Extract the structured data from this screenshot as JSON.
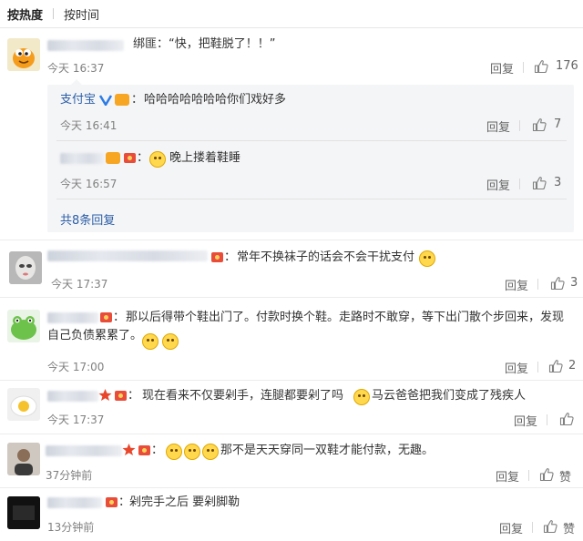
{
  "tabs": {
    "hot": "按热度",
    "time": "按时间"
  },
  "comments": [
    {
      "text": "绑匪：“快，把鞋脱了！！”",
      "time": "今天 16:37",
      "reply": "回复",
      "likes": "176",
      "replies": [
        {
          "name": "支付宝",
          "text": "哈哈哈哈哈哈哈你们戏好多",
          "time": "今天 16:41",
          "reply": "回复",
          "likes": "7"
        },
        {
          "text": "晚上搂着鞋睡",
          "time": "今天 16:57",
          "reply": "回复",
          "likes": "3"
        }
      ],
      "more": "共8条回复"
    },
    {
      "text": "常年不换袜子的话会不会干扰支付",
      "time": "今天 17:37",
      "reply": "回复",
      "likes": "3"
    },
    {
      "text": "那以后得带个鞋出门了。付款时换个鞋。走路时不敢穿，等下出门散个步回来，发现自己负债累累了。",
      "time": "今天 17:00",
      "reply": "回复",
      "likes": "2"
    },
    {
      "text_a": "现在看来不仅要剁手，连腿都要剁了吗",
      "text_b": "马云爸爸把我们变成了残疾人",
      "time": "今天 17:37",
      "reply": "回复",
      "likes": ""
    },
    {
      "text": "那不是天天穿同一双鞋才能付款，无趣。",
      "time": "37分钟前",
      "reply": "回复",
      "likes": "赞"
    },
    {
      "text": "剁完手之后 要剁脚勒",
      "time": "13分钟前",
      "reply": "回复",
      "likes": "赞"
    }
  ],
  "colors": {
    "name_blue": "#2c5ea8",
    "link": "#2c5ea8",
    "timestamp": "#808080",
    "redpacket": "#e94d3a"
  }
}
